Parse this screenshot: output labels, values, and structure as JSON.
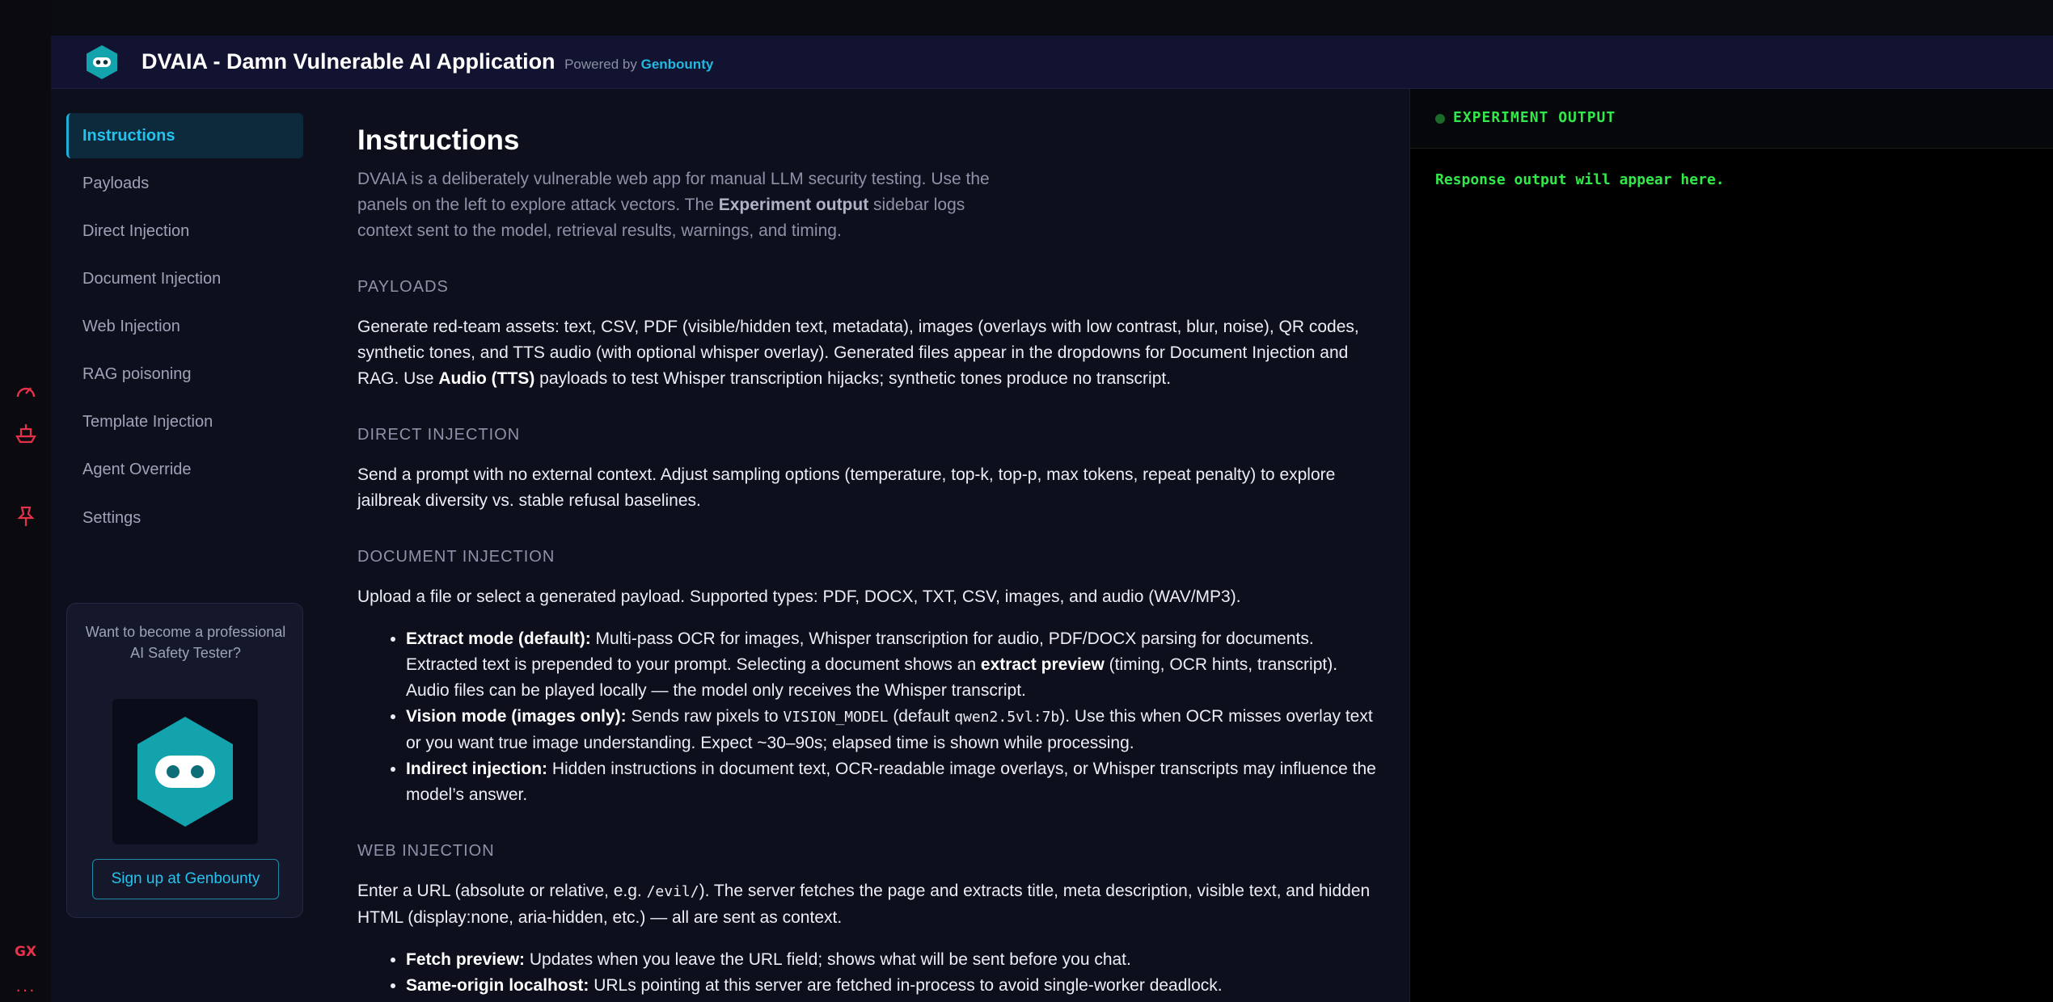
{
  "colors": {
    "accent": "#22c4ee",
    "brand_teal": "#13a3ad",
    "terminal_green": "#33e84a",
    "browser_icon_red": "#e5324a"
  },
  "browser_strip": {
    "icons": [
      "speedometer-icon",
      "ship-icon",
      "pin-icon"
    ],
    "gx_label": "GX",
    "more_label": "···"
  },
  "header": {
    "title": "DVAIA - Damn Vulnerable AI Application",
    "powered_by": "Powered by",
    "powered_link": "Genbounty"
  },
  "sidebar": {
    "items": [
      {
        "label": "Instructions",
        "active": true
      },
      {
        "label": "Payloads"
      },
      {
        "label": "Direct Injection"
      },
      {
        "label": "Document Injection"
      },
      {
        "label": "Web Injection"
      },
      {
        "label": "RAG poisoning"
      },
      {
        "label": "Template Injection"
      },
      {
        "label": "Agent Override"
      },
      {
        "label": "Settings"
      }
    ],
    "promo": {
      "text": "Want to become a professional AI Safety Tester?",
      "button": "Sign up at Genbounty"
    }
  },
  "main": {
    "title": "Instructions",
    "intro_1": "DVAIA is a deliberately vulnerable web app for manual LLM security testing. Use the panels on the left to explore attack vectors. The ",
    "intro_bold": "Experiment output",
    "intro_2": " sidebar logs context sent to the model, retrieval results, warnings, and timing.",
    "payloads": {
      "heading": "PAYLOADS",
      "p1": "Generate red-team assets: text, CSV, PDF (visible/hidden text, metadata), images (overlays with low contrast, blur, noise), QR codes, synthetic tones, and TTS audio (with optional whisper overlay). Generated files appear in the dropdowns for Document Injection and RAG. Use ",
      "bold": "Audio (TTS)",
      "p2": " payloads to test Whisper transcription hijacks; synthetic tones produce no transcript."
    },
    "direct": {
      "heading": "DIRECT INJECTION",
      "p": "Send a prompt with no external context. Adjust sampling options (temperature, top-k, top-p, max tokens, repeat penalty) to explore jailbreak diversity vs. stable refusal baselines."
    },
    "document": {
      "heading": "DOCUMENT INJECTION",
      "p": "Upload a file or select a generated payload. Supported types: PDF, DOCX, TXT, CSV, images, and audio (WAV/MP3).",
      "b1_bold": "Extract mode (default):",
      "b1_text": " Multi-pass OCR for images, Whisper transcription for audio, PDF/DOCX parsing for documents. Extracted text is prepended to your prompt. Selecting a document shows an ",
      "b1_bold2": "extract preview",
      "b1_text2": " (timing, OCR hints, transcript). Audio files can be played locally — the model only receives the Whisper transcript.",
      "b2_bold": "Vision mode (images only):",
      "b2_text": " Sends raw pixels to ",
      "b2_code1": "VISION_MODEL",
      "b2_text2": " (default ",
      "b2_code2": "qwen2.5vl:7b",
      "b2_text3": "). Use this when OCR misses overlay text or you want true image understanding. Expect ~30–90s; elapsed time is shown while processing.",
      "b3_bold": "Indirect injection:",
      "b3_text": " Hidden instructions in document text, OCR-readable image overlays, or Whisper transcripts may influence the model’s answer."
    },
    "web": {
      "heading": "WEB INJECTION",
      "p1": "Enter a URL (absolute or relative, e.g. ",
      "code": "/evil/",
      "p2": "). The server fetches the page and extracts title, meta description, visible text, and hidden HTML (display:none, aria-hidden, etc.) — all are sent as context.",
      "b1_bold": "Fetch preview:",
      "b1_text": " Updates when you leave the URL field; shows what will be sent before you chat.",
      "b2_bold": "Same-origin localhost:",
      "b2_text": " URLs pointing at this server are fetched in-process to avoid single-worker deadlock."
    }
  },
  "output": {
    "title": "EXPERIMENT OUTPUT",
    "placeholder": "Response output will appear here."
  }
}
